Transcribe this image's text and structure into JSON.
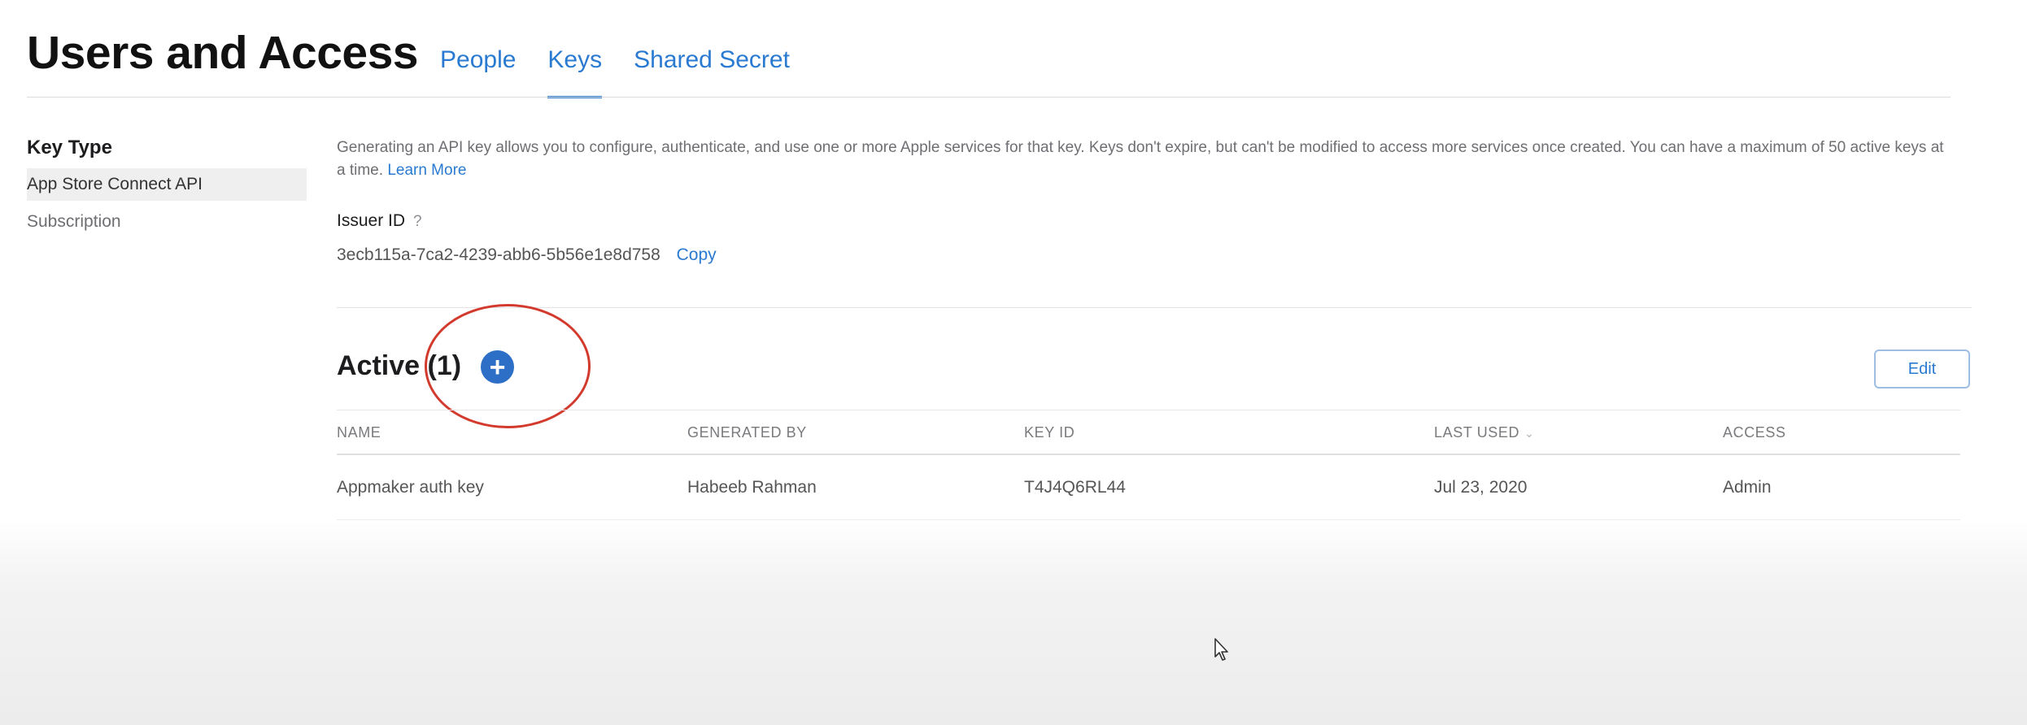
{
  "header": {
    "title": "Users and Access",
    "tabs": [
      {
        "label": "People",
        "active": false
      },
      {
        "label": "Keys",
        "active": true
      },
      {
        "label": "Shared Secret",
        "active": false
      }
    ]
  },
  "sidebar": {
    "heading": "Key Type",
    "items": [
      {
        "label": "App Store Connect API",
        "selected": true
      },
      {
        "label": "Subscription",
        "selected": false
      }
    ]
  },
  "main": {
    "description": "Generating an API key allows you to configure, authenticate, and use one or more Apple services for that key. Keys don't expire, but can't be modified to access more services once created. You can have a maximum of 50 active keys at a time.",
    "learn_more": "Learn More",
    "issuer": {
      "label": "Issuer ID",
      "help": "?",
      "value": "3ecb115a-7ca2-4239-abb6-5b56e1e8d758",
      "copy_label": "Copy"
    },
    "active_section": {
      "title": "Active (1)",
      "add_symbol": "+",
      "edit_label": "Edit"
    },
    "table": {
      "headers": {
        "name": "NAME",
        "generated_by": "GENERATED BY",
        "key_id": "KEY ID",
        "last_used": "LAST USED",
        "access": "ACCESS"
      },
      "sort_indicator": "⌄",
      "rows": [
        {
          "name": "Appmaker auth key",
          "generated_by": "Habeeb Rahman",
          "key_id": "T4J4Q6RL44",
          "last_used": "Jul 23, 2020",
          "access": "Admin"
        }
      ]
    }
  },
  "colors": {
    "link": "#2a7ad1",
    "add_button": "#2d6fc6",
    "annotation": "#d33a2e"
  },
  "icons": {
    "add": "plus-circle-icon",
    "help": "question-mark-icon",
    "cursor": "mouse-pointer-icon"
  }
}
